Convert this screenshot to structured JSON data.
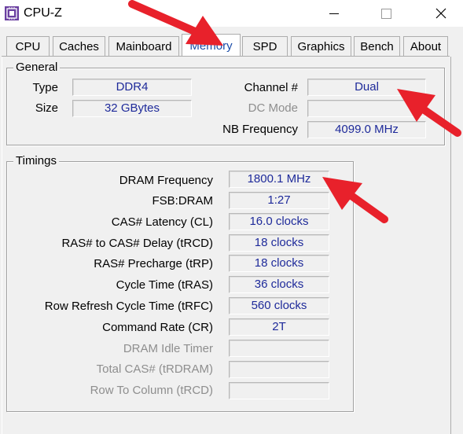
{
  "window": {
    "title": "CPU-Z"
  },
  "tabs": [
    {
      "label": "CPU"
    },
    {
      "label": "Caches"
    },
    {
      "label": "Mainboard"
    },
    {
      "label": "Memory"
    },
    {
      "label": "SPD"
    },
    {
      "label": "Graphics"
    },
    {
      "label": "Bench"
    },
    {
      "label": "About"
    }
  ],
  "general": {
    "title": "General",
    "type": {
      "label": "Type",
      "value": "DDR4"
    },
    "size": {
      "label": "Size",
      "value": "32 GBytes"
    },
    "channel": {
      "label": "Channel #",
      "value": "Dual"
    },
    "dc_mode": {
      "label": "DC Mode",
      "value": ""
    },
    "nb_frequency": {
      "label": "NB Frequency",
      "value": "4099.0 MHz"
    }
  },
  "timings": {
    "title": "Timings",
    "rows": [
      {
        "label": "DRAM Frequency",
        "value": "1800.1 MHz"
      },
      {
        "label": "FSB:DRAM",
        "value": "1:27"
      },
      {
        "label": "CAS# Latency (CL)",
        "value": "16.0 clocks"
      },
      {
        "label": "RAS# to CAS# Delay (tRCD)",
        "value": "18 clocks"
      },
      {
        "label": "RAS# Precharge (tRP)",
        "value": "18 clocks"
      },
      {
        "label": "Cycle Time (tRAS)",
        "value": "36 clocks"
      },
      {
        "label": "Row Refresh Cycle Time (tRFC)",
        "value": "560 clocks"
      },
      {
        "label": "Command Rate (CR)",
        "value": "2T"
      },
      {
        "label": "DRAM Idle Timer",
        "value": ""
      },
      {
        "label": "Total CAS# (tRDRAM)",
        "value": ""
      },
      {
        "label": "Row To Column (tRCD)",
        "value": ""
      }
    ]
  },
  "colors": {
    "accent": "#1a4ba8",
    "value_text": "#1e2a9a",
    "arrow": "#e8212b",
    "window_bg": "#f0f0f0",
    "app_icon": "#6a3fa0"
  },
  "icons": {
    "app": "cpu-z-icon",
    "minimize": "minimize-icon",
    "maximize": "maximize-icon",
    "close": "close-icon",
    "annotation": "red-arrow-icon"
  }
}
